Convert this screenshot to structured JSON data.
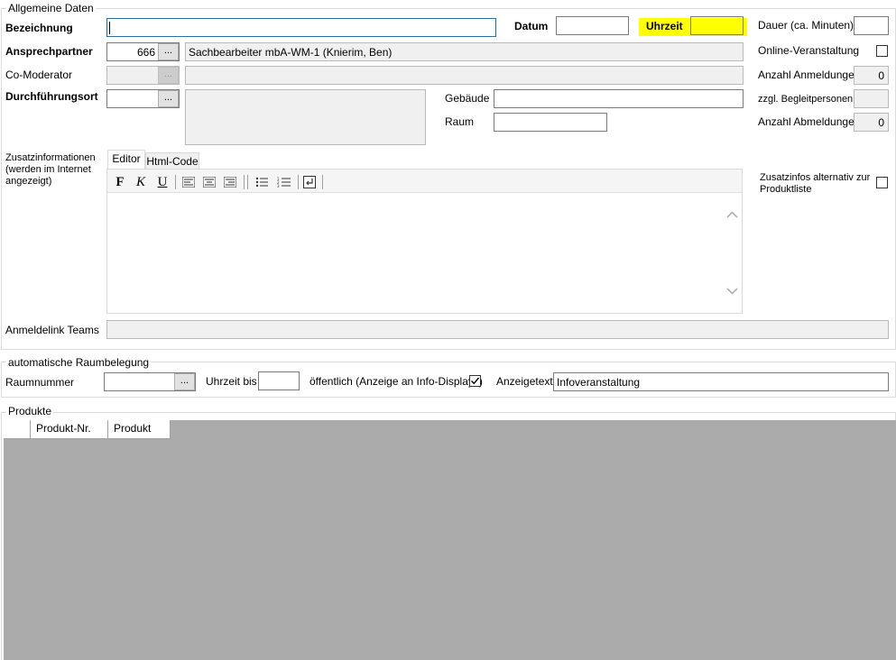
{
  "general": {
    "legend": "Allgemeine Daten",
    "bezeichnung_label": "Bezeichnung",
    "bezeichnung_value": "",
    "datum_label": "Datum",
    "datum_value": "",
    "uhrzeit_label": "Uhrzeit",
    "uhrzeit_value": "",
    "dauer_label": "Dauer (ca. Minuten)",
    "dauer_value": "",
    "ansprechpartner_label": "Ansprechpartner",
    "ansprechpartner_id": "666",
    "ansprechpartner_name": "Sachbearbeiter mbA-WM-1 (Knierim, Ben)",
    "online_label": "Online-Veranstaltung",
    "online_checked": false,
    "comoderator_label": "Co-Moderator",
    "anmeldungen_label": "Anzahl Anmeldungen",
    "anmeldungen_value": "0",
    "durchfuehrungsort_label": "Durchführungsort",
    "gebaeude_label": "Gebäude",
    "raum_label": "Raum",
    "begleitpersonen_label": "zzgl. Begleitpersonen",
    "begleitpersonen_value": "",
    "abmeldungen_label": "Anzahl Abmeldungen",
    "abmeldungen_value": "0",
    "dots_label": "...",
    "zusatz_label_1": "Zusatzinformationen",
    "zusatz_label_2": "(werden im Internet",
    "zusatz_label_3": "angezeigt)",
    "tab_editor": "Editor",
    "tab_html": "Html-Code",
    "bold_label": "F",
    "italic_label": "K",
    "underline_label": "U",
    "zusatz_alt_label_1": "Zusatzinfos alternativ zur",
    "zusatz_alt_label_2": "Produktliste",
    "zusatz_alt_checked": false,
    "anmeldelink_label": "Anmeldelink Teams",
    "anmeldelink_value": ""
  },
  "room": {
    "legend": "automatische Raumbelegung",
    "raumnummer_label": "Raumnummer",
    "uhrzeit_bis_label": "Uhrzeit bis",
    "oeffentlich_label": "öffentlich (Anzeige an Info-Displays)",
    "oeffentlich_checked": true,
    "anzeigetext_label": "Anzeigetext",
    "anzeigetext_value": "Infoveranstaltung"
  },
  "products": {
    "legend": "Produkte",
    "columns": [
      "Produkt-Nr.",
      "Produkt"
    ]
  },
  "colors": {
    "highlight": "#ffff00",
    "focus_border": "#0078d7",
    "grid_background": "#ababab",
    "disabled_background": "#f0f0f0"
  }
}
